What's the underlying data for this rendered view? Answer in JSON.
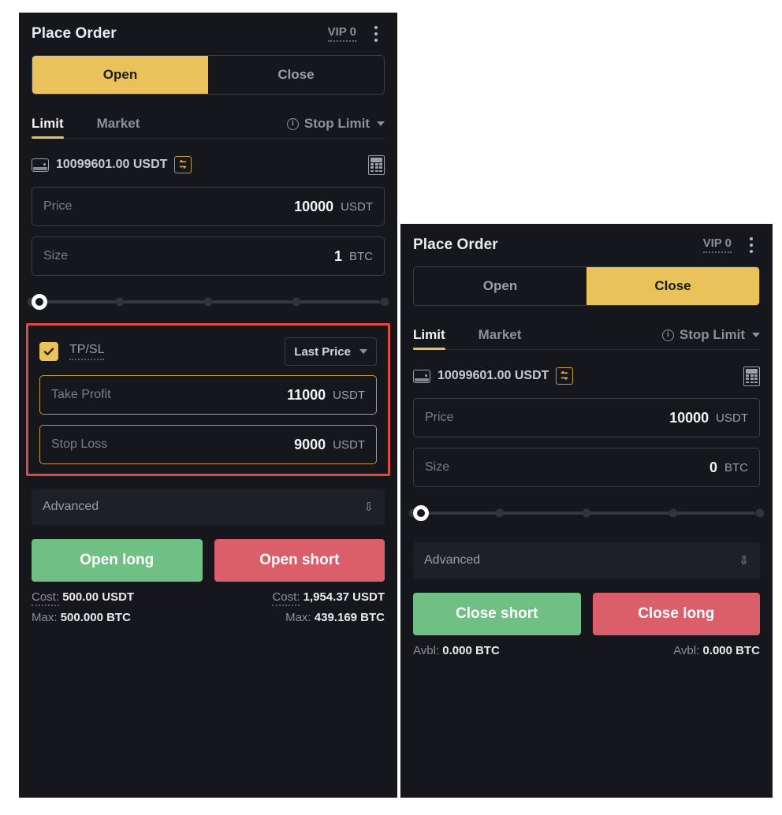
{
  "panels": {
    "left": {
      "header": {
        "title": "Place Order",
        "vip": "VIP 0",
        "menu_icon": "kebab-menu-icon"
      },
      "segmented": {
        "open": "Open",
        "close": "Close",
        "active": "Open"
      },
      "tabs": {
        "limit": "Limit",
        "market": "Market",
        "stop_limit": "Stop Limit",
        "active": "Limit"
      },
      "balance": {
        "amount": "10099601.00 USDT",
        "swap_icon": "swap-icon",
        "calculator_icon": "calculator-icon"
      },
      "price_field": {
        "placeholder": "Price",
        "value": "10000",
        "unit": "USDT"
      },
      "size_field": {
        "placeholder": "Size",
        "value": "1",
        "unit": "BTC"
      },
      "slider": {
        "value": 0,
        "ticks": [
          0,
          25,
          50,
          75,
          100
        ]
      },
      "tpsl": {
        "checked": true,
        "label": "TP/SL",
        "trigger_select": "Last Price",
        "take_profit": {
          "placeholder": "Take Profit",
          "value": "11000",
          "unit": "USDT"
        },
        "stop_loss": {
          "placeholder": "Stop Loss",
          "value": "9000",
          "unit": "USDT"
        },
        "highlight_color": "#e04a3c"
      },
      "advanced": {
        "label": "Advanced",
        "chevron": "chevron-double-down-icon"
      },
      "buttons": {
        "primary": "Open long",
        "secondary": "Open short"
      },
      "stats": {
        "left": [
          {
            "key": "Cost:",
            "value": "500.00 USDT"
          },
          {
            "key": "Max:",
            "value": "500.000 BTC"
          }
        ],
        "right": [
          {
            "key": "Cost:",
            "value": "1,954.37 USDT"
          },
          {
            "key": "Max:",
            "value": "439.169 BTC"
          }
        ]
      }
    },
    "right": {
      "header": {
        "title": "Place Order",
        "vip": "VIP 0",
        "menu_icon": "kebab-menu-icon"
      },
      "segmented": {
        "open": "Open",
        "close": "Close",
        "active": "Close"
      },
      "tabs": {
        "limit": "Limit",
        "market": "Market",
        "stop_limit": "Stop Limit",
        "active": "Limit"
      },
      "balance": {
        "amount": "10099601.00 USDT",
        "swap_icon": "swap-icon",
        "calculator_icon": "calculator-icon"
      },
      "price_field": {
        "placeholder": "Price",
        "value": "10000",
        "unit": "USDT"
      },
      "size_field": {
        "placeholder": "Size",
        "value": "0",
        "unit": "BTC"
      },
      "slider": {
        "value": 0,
        "ticks": [
          0,
          25,
          50,
          75,
          100
        ]
      },
      "advanced": {
        "label": "Advanced",
        "chevron": "chevron-double-down-icon"
      },
      "buttons": {
        "primary": "Close short",
        "secondary": "Close long"
      },
      "stats": {
        "left": [
          {
            "key": "Avbl:",
            "value": "0.000 BTC"
          }
        ],
        "right": [
          {
            "key": "Avbl:",
            "value": "0.000 BTC"
          }
        ]
      }
    }
  },
  "colors": {
    "accent": "#e9c25b",
    "panel_bg": "#15171c",
    "long_green": "#70bf84",
    "short_red": "#db5f6b",
    "highlight_red": "#e04a3c"
  }
}
